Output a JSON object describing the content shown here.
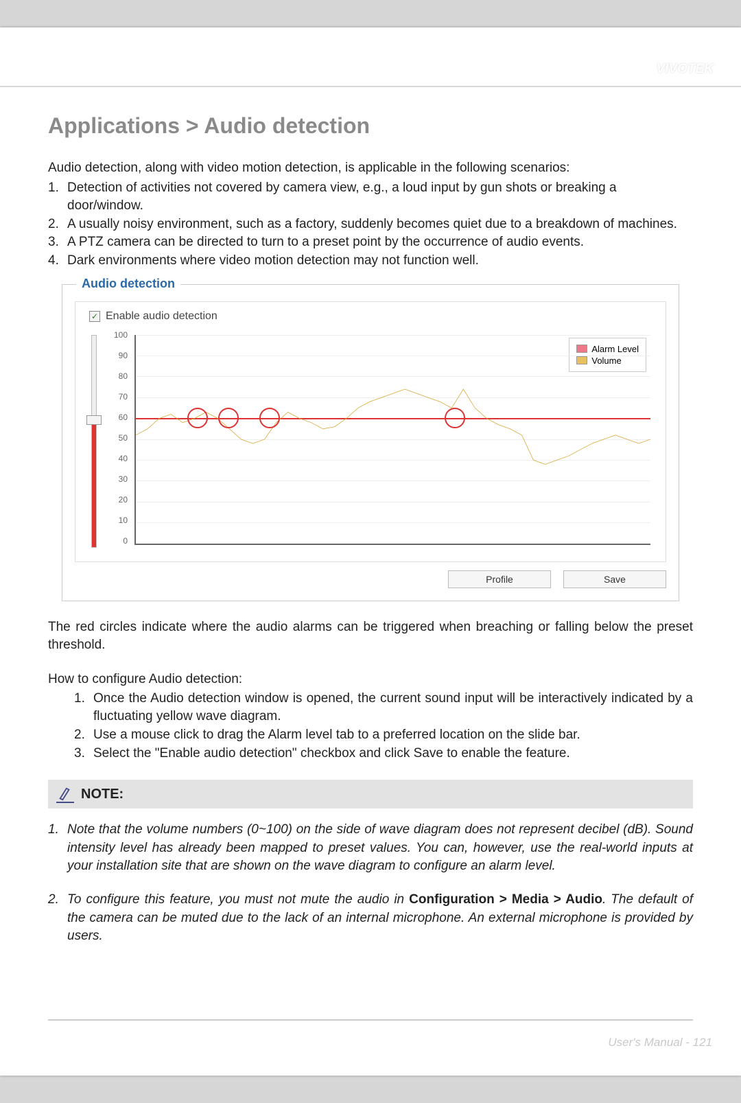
{
  "header": {
    "brand": "VIVOTEK"
  },
  "title": "Applications > Audio detection",
  "intro": "Audio detection, along with video motion detection, is applicable in the following scenarios:",
  "scenarios": [
    "Detection of activities not covered by camera view, e.g., a loud input by gun shots or breaking a door/window.",
    "A usually noisy environment, such as a factory, suddenly becomes quiet due to a breakdown of machines.",
    "A PTZ camera can be directed to turn to a preset point by the occurrence of audio events.",
    "Dark environments where video motion detection may not function well."
  ],
  "panel": {
    "title": "Audio detection",
    "checkbox_label": "Enable audio detection",
    "checkbox_checked": true,
    "legend": {
      "alarm": "Alarm Level",
      "volume": "Volume"
    },
    "buttons": {
      "profile": "Profile",
      "save": "Save"
    }
  },
  "chart_data": {
    "type": "line",
    "title": "",
    "xlabel": "",
    "ylabel": "",
    "ylim": [
      0,
      100
    ],
    "y_ticks": [
      0,
      10,
      20,
      30,
      40,
      50,
      60,
      70,
      80,
      90,
      100
    ],
    "alarm_level": 60,
    "series": [
      {
        "name": "Volume",
        "color": "#d8a83a",
        "values": [
          52,
          55,
          60,
          62,
          58,
          60,
          63,
          60,
          55,
          50,
          48,
          50,
          58,
          63,
          60,
          58,
          55,
          56,
          60,
          65,
          68,
          70,
          72,
          74,
          72,
          70,
          68,
          65,
          74,
          65,
          60,
          57,
          55,
          52,
          40,
          38,
          40,
          42,
          45,
          48,
          50,
          52,
          50,
          48,
          50
        ]
      }
    ],
    "alarm_trigger_points_x_pct": [
      12,
      18,
      26,
      62
    ]
  },
  "caption": "The red circles indicate where the audio alarms can be triggered when breaching or falling below the preset threshold.",
  "howto_title": "How to configure Audio detection:",
  "howto": [
    "Once the Audio detection window is opened, the current sound input will be interactively indicated by a fluctuating yellow wave diagram.",
    "Use a mouse click to drag the Alarm level tab to a preferred location on the slide bar.",
    "Select the \"Enable audio detection\" checkbox and click Save to enable the feature."
  ],
  "note_label": "NOTE:",
  "notes": [
    {
      "pre": "Note that the volume numbers (0~100) on the side of wave diagram does not represent decibel (dB). Sound intensity level has already been mapped to preset values. You can, however, use the real-world inputs at your installation site that are shown on the wave diagram to configure an alarm level.",
      "bold": "",
      "post": ""
    },
    {
      "pre": "To configure this feature, you must not mute the audio in ",
      "bold": "Configuration > Media > Audio",
      "post": ". The default of the camera can be muted due to the lack of an internal microphone. An external microphone is provided by users."
    }
  ],
  "footer": "User's Manual - 121"
}
